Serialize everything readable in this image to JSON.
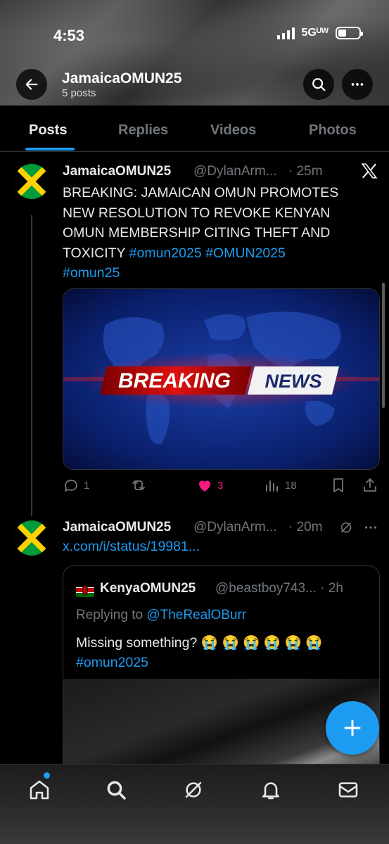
{
  "status_bar": {
    "time": "4:53",
    "network": "5Gᵁᵂ"
  },
  "header": {
    "title": "JamaicaOMUN25",
    "subtitle": "5 posts"
  },
  "tabs": [
    {
      "label": "Posts",
      "active": true
    },
    {
      "label": "Replies"
    },
    {
      "label": "Videos"
    },
    {
      "label": "Photos"
    }
  ],
  "posts": [
    {
      "name": "JamaicaOMUN25",
      "handle": "@DylanArm...",
      "time": "· 25m",
      "text_before": "BREAKING: JAMAICAN OMUN PROMOTES NEW RESOLUTION TO REVOKE KENYAN OMUN MEMBERSHIP CITING THEFT AND TOXICITY ",
      "hashtag1": "#omun2025",
      "hashtag2": "#OMUN2025",
      "hashtag3": "#omun25",
      "media": {
        "banner_left": "BREAKING",
        "banner_right": "NEWS"
      },
      "actions": {
        "replies": "1",
        "reposts": "",
        "likes": "3",
        "views": "18"
      }
    },
    {
      "name": "JamaicaOMUN25",
      "handle": "@DylanArm...",
      "time": "· 20m",
      "link": "x.com/i/status/19981...",
      "quote": {
        "name": "KenyaOMUN25",
        "handle": "@beastboy743... · 2h",
        "replying_prefix": "Replying to ",
        "replying_handle": "@TheRealOBurr",
        "text": "Missing something? 😭 😭 😭 😭 😭 😭",
        "hashtag": "#omun2025"
      }
    }
  ],
  "colors": {
    "accent": "#1d9bf0",
    "like": "#f91880",
    "muted": "#71767b"
  }
}
